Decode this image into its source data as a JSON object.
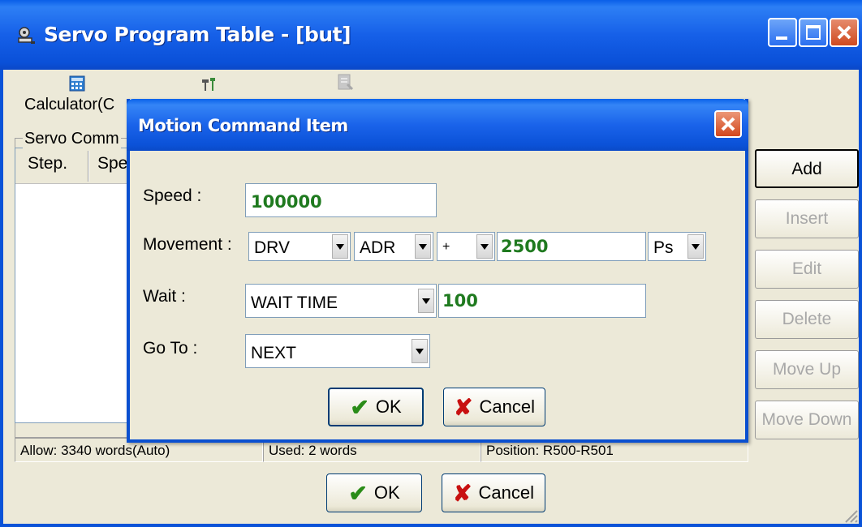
{
  "main_window": {
    "title": "Servo Program Table - [but]",
    "toolbar": {
      "calculator_label": "Calculator(C"
    },
    "group_label": "Servo Comm",
    "list_columns": [
      "Step.",
      "Spe"
    ],
    "side_buttons": {
      "add": "Add",
      "insert": "Insert",
      "edit": "Edit",
      "delete": "Delete",
      "move_up": "Move Up",
      "move_down": "Move Down"
    },
    "status": {
      "allow": "Allow: 3340 words(Auto)",
      "used": "Used: 2 words",
      "position": "Position: R500-R501"
    },
    "ok_label": "OK",
    "cancel_label": "Cancel"
  },
  "dialog": {
    "title": "Motion Command Item",
    "speed_label": "Speed :",
    "speed_value": "100000",
    "movement_label": "Movement :",
    "movement_type": "DRV",
    "movement_mode": "ADR",
    "movement_sign": "+",
    "movement_value": "2500",
    "movement_unit": "Ps",
    "wait_label": "Wait :",
    "wait_type": "WAIT TIME",
    "wait_value": "100",
    "goto_label": "Go To :",
    "goto_value": "NEXT",
    "ok_label": "OK",
    "cancel_label": "Cancel"
  },
  "colors": {
    "titlebar_blue": "#0a5fe8",
    "value_green": "#1f7a1f",
    "window_bg": "#ece9d8"
  }
}
